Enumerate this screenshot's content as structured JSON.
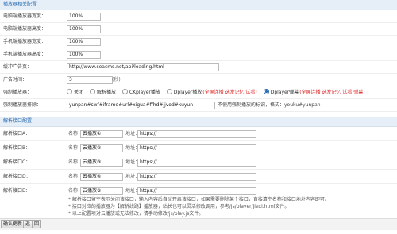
{
  "player_section": {
    "title": "播放器相关配置"
  },
  "pc_width": {
    "label": "电脑端播放器宽度：",
    "value": "100%"
  },
  "pc_height": {
    "label": "电脑端播放器高度：",
    "value": "100%"
  },
  "mobile_width": {
    "label": "手机端播放器宽度：",
    "value": "100%"
  },
  "mobile_height": {
    "label": "手机端播放器高度：",
    "value": "100%"
  },
  "ad_page": {
    "label": "缓冲广告页：",
    "value": "http://www.seacms.net/api/loading.html"
  },
  "ad_time": {
    "label": "广告时间：",
    "value": "3",
    "unit": "(秒)"
  },
  "force_player": {
    "label": "强制播放器：",
    "options": [
      "关闭",
      "解析播放",
      "CKplayer播放",
      "Dplayer播放",
      "Dplayer弹幕"
    ],
    "selected_index": 4,
    "dplayer_note": "(全屏连播 选发记忆 试看)",
    "danmu_note": "(全屏连播 选发记忆 试看 弹幕)"
  },
  "force_exclude": {
    "label": "强制播放器排除：",
    "value": "yunpan#swf#iframe#url#xigua#ffhd#jjvod#kuyun",
    "hint": "不使用强制播放的标识，格式：youku#yunpan"
  },
  "parse_section": {
    "title": "解析接口配置"
  },
  "interfaces": [
    {
      "label": "解析接口A：",
      "name_label": "名称：",
      "name_value": "云播放①",
      "addr_label": "地址：",
      "addr_value": "https://"
    },
    {
      "label": "解析接口B：",
      "name_label": "名称：",
      "name_value": "云播放②",
      "addr_label": "地址：",
      "addr_value": "https://"
    },
    {
      "label": "解析接口C：",
      "name_label": "名称：",
      "name_value": "云播放③",
      "addr_label": "地址：",
      "addr_value": "https://"
    },
    {
      "label": "解析接口D：",
      "name_label": "名称：",
      "name_value": "云播放④",
      "addr_label": "地址：",
      "addr_value": "https://"
    },
    {
      "label": "解析接口E：",
      "name_label": "名称：",
      "name_value": "云播放⑤",
      "addr_label": "地址：",
      "addr_value": "https://"
    }
  ],
  "notes": [
    "* 解析接口留空表示关闭该接口，输入内容后自动开启该接口，如果需要删除某个接口，直接清空名称和接口地址内容即可。",
    "* 接口对应的播放器为【解析线路】播放器，站长也可以灵活修改调用，参考/js/player/jiexi.html文件。",
    "* 以上配置项对云播放或无法修改，请手动修改/js/play.js文件。"
  ],
  "buttons": {
    "confirm": "确认更新",
    "back": "返",
    "reset": "回"
  }
}
